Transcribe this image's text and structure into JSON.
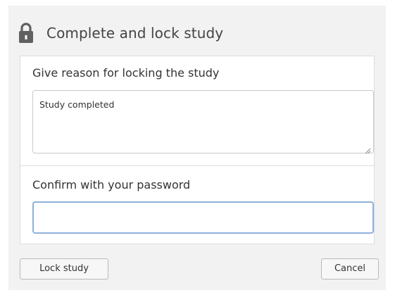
{
  "dialog": {
    "title": "Complete and lock study",
    "lock_icon": "lock-icon"
  },
  "reason": {
    "label": "Give reason for locking the study",
    "value": "Study completed"
  },
  "password": {
    "label": "Confirm with your password",
    "value": ""
  },
  "buttons": {
    "lock_label": "Lock study",
    "cancel_label": "Cancel"
  },
  "colors": {
    "dialog_background": "#f2f2f2",
    "focus_border": "#8fb0dc"
  }
}
